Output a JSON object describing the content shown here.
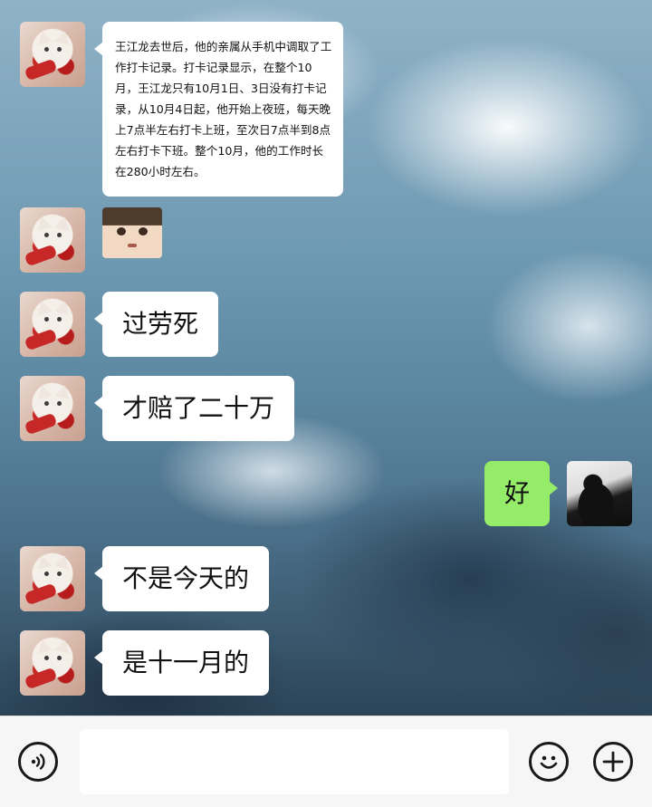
{
  "chat": {
    "messages": [
      {
        "side": "left",
        "type": "text",
        "text": "王江龙去世后，他的亲属从手机中调取了工作打卡记录。打卡记录显示，在整个10月，王江龙只有10月1日、3日没有打卡记录，从10月4日起，他开始上夜班，每天晚上7点半左右打卡上班，至次日7点半到8点左右打卡下班。整个10月，他的工作时长在280小时左右。"
      },
      {
        "side": "left",
        "type": "sticker",
        "icon": "anime-face-sticker"
      },
      {
        "side": "left",
        "type": "text",
        "text": "过劳死"
      },
      {
        "side": "left",
        "type": "text",
        "text": "才赔了二十万"
      },
      {
        "side": "right",
        "type": "text",
        "text": "好"
      },
      {
        "side": "left",
        "type": "text",
        "text": "不是今天的"
      },
      {
        "side": "left",
        "type": "text",
        "text": "是十一月的"
      }
    ]
  },
  "input_bar": {
    "voice_icon": "voice-icon",
    "emoji_icon": "emoji-icon",
    "plus_icon": "plus-icon",
    "value": ""
  },
  "colors": {
    "bubble_left": "#ffffff",
    "bubble_right": "#95ec69",
    "input_bar_bg": "#f6f6f6"
  }
}
